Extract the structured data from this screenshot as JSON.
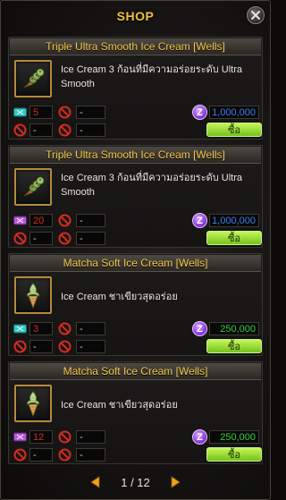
{
  "window": {
    "title": "SHOP"
  },
  "items": [
    {
      "name": "Triple Ultra Smooth Ice Cream [Wells]",
      "desc": "Ice Cream 3 ก้อนที่มีความอร่อยระดับ Ultra Smooth",
      "icon": "ice-cream-cone-icon",
      "qty": "5",
      "field1": "-",
      "field2": "-",
      "field3": "-",
      "price": "1,000,000",
      "price_color": "#3c7ff0",
      "buy_label": "ซื้อ"
    },
    {
      "name": "Triple Ultra Smooth Ice Cream [Wells]",
      "desc": "Ice Cream 3 ก้อนที่มีความอร่อยระดับ Ultra Smooth",
      "icon": "ice-cream-cone-icon",
      "qty": "20",
      "field1": "-",
      "field2": "-",
      "field3": "-",
      "price": "1,000,000",
      "price_color": "#3c7ff0",
      "buy_label": "ซื้อ"
    },
    {
      "name": "Matcha Soft Ice Cream [Wells]",
      "desc": "Ice Cream ชาเขียวสุดอร่อย",
      "icon": "soft-serve-cone-icon",
      "qty": "3",
      "field1": "-",
      "field2": "-",
      "field3": "-",
      "price": "250,000",
      "price_color": "#34d13a",
      "buy_label": "ซื้อ"
    },
    {
      "name": "Matcha Soft Ice Cream [Wells]",
      "desc": "Ice Cream ชาเขียวสุดอร่อย",
      "icon": "soft-serve-cone-icon",
      "qty": "12",
      "field1": "-",
      "field2": "-",
      "field3": "-",
      "price": "250,000",
      "price_color": "#34d13a",
      "buy_label": "ซื้อ"
    }
  ],
  "currency": {
    "symbol": "Z",
    "icon": "zeny-coin-icon"
  },
  "pagination": {
    "label": "1 / 12"
  },
  "icons": {
    "ticket": "ticket-icon",
    "no": "prohibited-icon",
    "close": "close-icon",
    "prev": "prev-page-icon",
    "next": "next-page-icon"
  }
}
